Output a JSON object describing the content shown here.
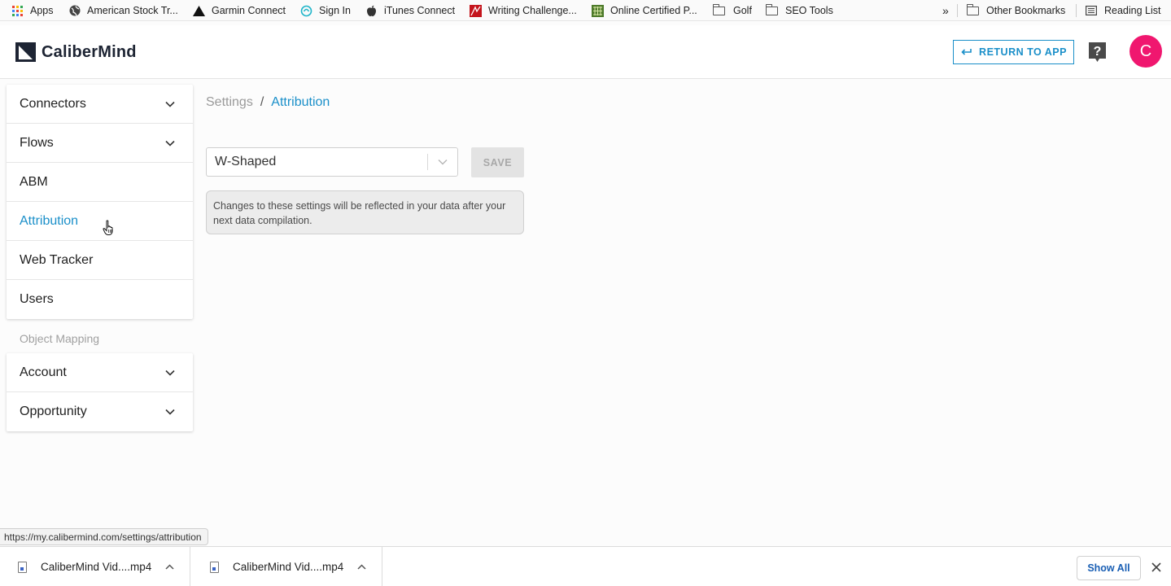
{
  "bookmarks": {
    "items": [
      {
        "label": "Apps",
        "icon": "apps-grid-icon"
      },
      {
        "label": "American Stock Tr...",
        "icon": "globe-icon"
      },
      {
        "label": "Garmin Connect",
        "icon": "garmin-triangle-icon"
      },
      {
        "label": "Sign In",
        "icon": "sign-in-swirl-icon"
      },
      {
        "label": "iTunes Connect",
        "icon": "apple-icon"
      },
      {
        "label": "Writing Challenge...",
        "icon": "writing-challenge-icon"
      },
      {
        "label": "Online Certified P...",
        "icon": "certified-icon"
      },
      {
        "label": "Golf",
        "icon": "folder-icon"
      },
      {
        "label": "SEO Tools",
        "icon": "folder-icon"
      }
    ],
    "overflow_label": "»",
    "other_bookmarks": "Other Bookmarks",
    "reading_list": "Reading List"
  },
  "header": {
    "logo_text": "CaliberMind",
    "return_button": "RETURN TO APP",
    "help_icon": "question-mark-icon",
    "avatar_letter": "C",
    "avatar_color": "#f0176f"
  },
  "sidebar": {
    "main_items": [
      {
        "label": "Connectors",
        "expandable": true
      },
      {
        "label": "Flows",
        "expandable": true
      },
      {
        "label": "ABM",
        "expandable": false
      },
      {
        "label": "Attribution",
        "expandable": false,
        "active": true
      },
      {
        "label": "Web Tracker",
        "expandable": false
      },
      {
        "label": "Users",
        "expandable": false
      }
    ],
    "section_label": "Object Mapping",
    "mapping_items": [
      {
        "label": "Account",
        "expandable": true
      },
      {
        "label": "Opportunity",
        "expandable": true
      }
    ]
  },
  "main": {
    "breadcrumb": {
      "parent": "Settings",
      "separator": "/",
      "current": "Attribution"
    },
    "model_select": {
      "value": "W-Shaped"
    },
    "save_label": "SAVE",
    "notice_text": "Changes to these settings will be reflected in your data after your next data compilation."
  },
  "status_url": "https://my.calibermind.com/settings/attribution",
  "downloads": {
    "items": [
      {
        "name": "CaliberMind Vid....mp4"
      },
      {
        "name": "CaliberMind Vid....mp4"
      }
    ],
    "show_all": "Show All"
  },
  "colors": {
    "accent": "#1a8fc9",
    "brand_dark": "#1d2433"
  }
}
